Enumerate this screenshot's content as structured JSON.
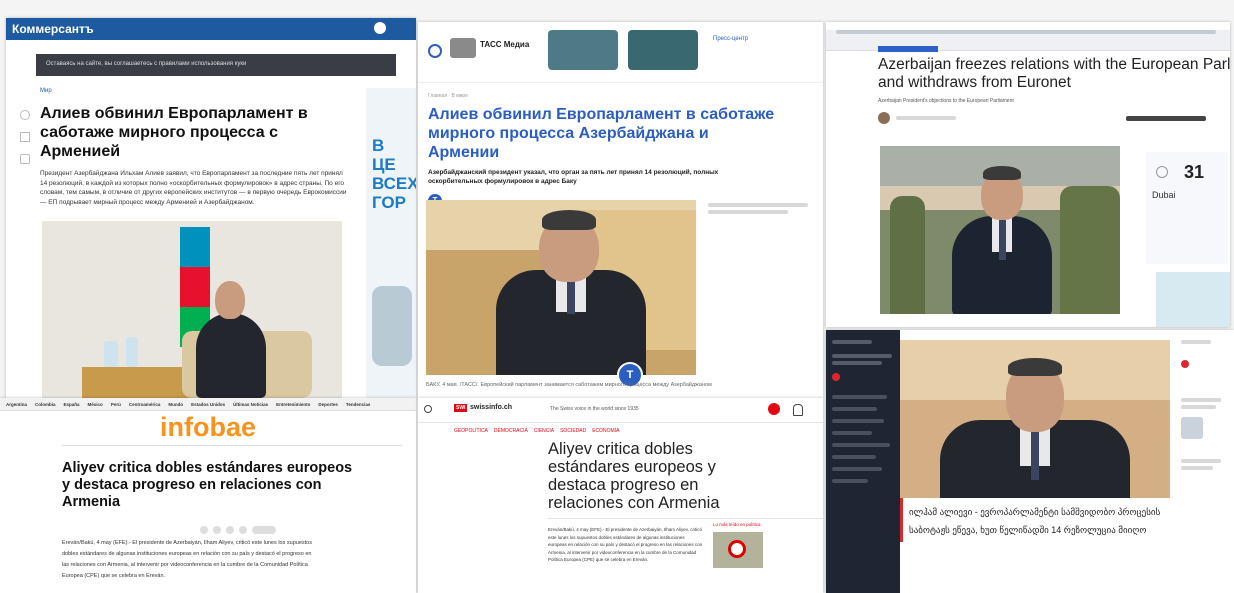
{
  "colors": {
    "kommersant_bar": "#1e5aa0",
    "tass_blue": "#2a5ec1",
    "infobae_orange": "#f7931e",
    "swi_red": "#e30613",
    "geo_sidebar": "#202533"
  },
  "kommersant": {
    "logo": "Коммерсантъ",
    "cookie": "Оставаясь на сайте, вы соглашаетесь с правилами использования куки",
    "rubric": "Мир",
    "title": "Алиев обвинил Европарламент в саботаже мирного процесса с Арменией",
    "lead": "Президент Азербайджана Ильхам Алиев заявил, что Европарламент за последние пять лет принял 14 резолюций, в каждой из которых полно «оскорбительных формулировок» в адрес страны. По его словам, тем самым, в отличие от других европейских институтов — в первую очередь Еврокомиссии — ЕП подрывает мирный процесс между Арменией и Азербайджаном.",
    "ad_text": "В ЦЕ ВСЕХ ГОР"
  },
  "tass": {
    "brand": "ТАСС Медиа",
    "press_center": "Пресс-центр",
    "breadcrumb": "Главная · В мире",
    "title": "Алиев обвинил Европарламент в саботаже мирного процесса Азербайджана и Армении",
    "subtitle": "Азербайджанский президент указал, что орган за пять лет принял 14 резолюций, полных оскорбительных формулировок в адрес Баку",
    "dateline": "БАКУ, 4 мая. /ТАСС/. Европейский парламент занимается саботажем мирного процесса между Азербайджаном",
    "avatar_letter": "T"
  },
  "euronet": {
    "title": "Azerbaijan freezes relations with the European Parliament and withdraws from Euronet",
    "subtitle": "Azerbaijan President's objections to the European Parliament",
    "weather_temp": "31",
    "weather_city": "Dubai"
  },
  "infobae": {
    "nav": [
      "Argentina",
      "Colombia",
      "España",
      "México",
      "Perú",
      "Centroamérica",
      "Mundo",
      "Estados Unidos",
      "Últimas Noticias",
      "Entretenimiento",
      "Deportes",
      "Tendencias"
    ],
    "logo": "infobae",
    "title": "Aliyev critica dobles estándares europeos y destaca progreso en relaciones con Armenia",
    "body": "Ereván/Bakú, 4 may (EFE).- El presidente de Azerbaiyán, Ilham Aliyev, criticó este lunes los supuestos dobles estándares de algunas instituciones europeas en relación con su país y destacó el progreso en las relaciones con Armenia, al intervenir por videoconferencia en la cumbre de la Comunidad Política Europea (CPE) que se celebra en Ereván."
  },
  "swissinfo": {
    "brand_badge": "SWI",
    "brand": "swissinfo.ch",
    "tagline": "The Swiss voice in the world since 1935",
    "nav": [
      "GEOPOLÍTICA",
      "DEMOCRACIA",
      "CIENCIA",
      "SOCIEDAD",
      "ECONOMÍA"
    ],
    "title": "Aliyev critica dobles estándares europeos y destaca progreso en relaciones con Armenia",
    "body": "Ereván/Bakú, 4 may (EFE).- El presidente de Azerbaiyán, Ilham Aliyev, criticó este lunes los supuestos dobles estándares de algunas instituciones europeas en relación con su país y destacó el progreso en las relaciones con Armenia, al intervenir por videoconferencia en la cumbre de la Comunidad Política Europea (CPE) que se celebra en Ereván.",
    "sidebar_title": "Lo más leído en política"
  },
  "georgian": {
    "caption": "ილჰამ ალიევი - ევროპარლამენტი სამშვიდობო პროცესის საბოტაჟს ეწევა, ხუთ წელიწადში 14 რეზოლუცია მიიღო"
  }
}
